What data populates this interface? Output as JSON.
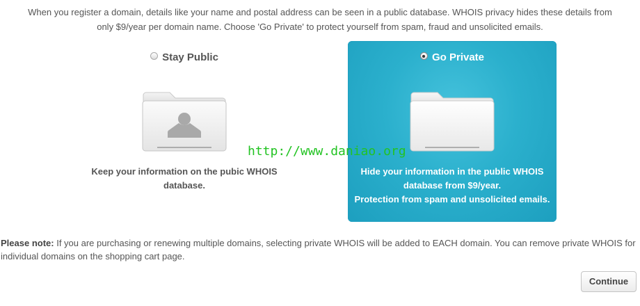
{
  "intro": {
    "line1": "When you register a domain, details like your name and postal address can be seen in a public database. WHOIS privacy hides these details from",
    "line2": "only $9/year per domain name. Choose 'Go Private' to protect yourself from spam, fraud and unsolicited emails."
  },
  "options": {
    "public": {
      "label": "Stay Public",
      "selected": false,
      "icon": "folder-person-icon",
      "desc_line1": "Keep your information on the pubic WHOIS",
      "desc_line2": "database."
    },
    "private": {
      "label": "Go Private",
      "selected": true,
      "icon": "folder-icon",
      "desc_line1": "Hide your information in the public WHOIS",
      "desc_line2": "database from $9/year.",
      "desc_line3": "Protection from spam and unsolicited emails."
    }
  },
  "watermark": "http://www.daniao.org",
  "note": {
    "label": "Please note:",
    "text": " If you are purchasing or renewing multiple domains, selecting private WHOIS will be added to EACH domain. You can remove private WHOIS for individual domains on the shopping cart page."
  },
  "continue_label": "Continue",
  "colors": {
    "accent": "#2bb0cd",
    "text": "#555555",
    "watermark": "#22c322"
  }
}
